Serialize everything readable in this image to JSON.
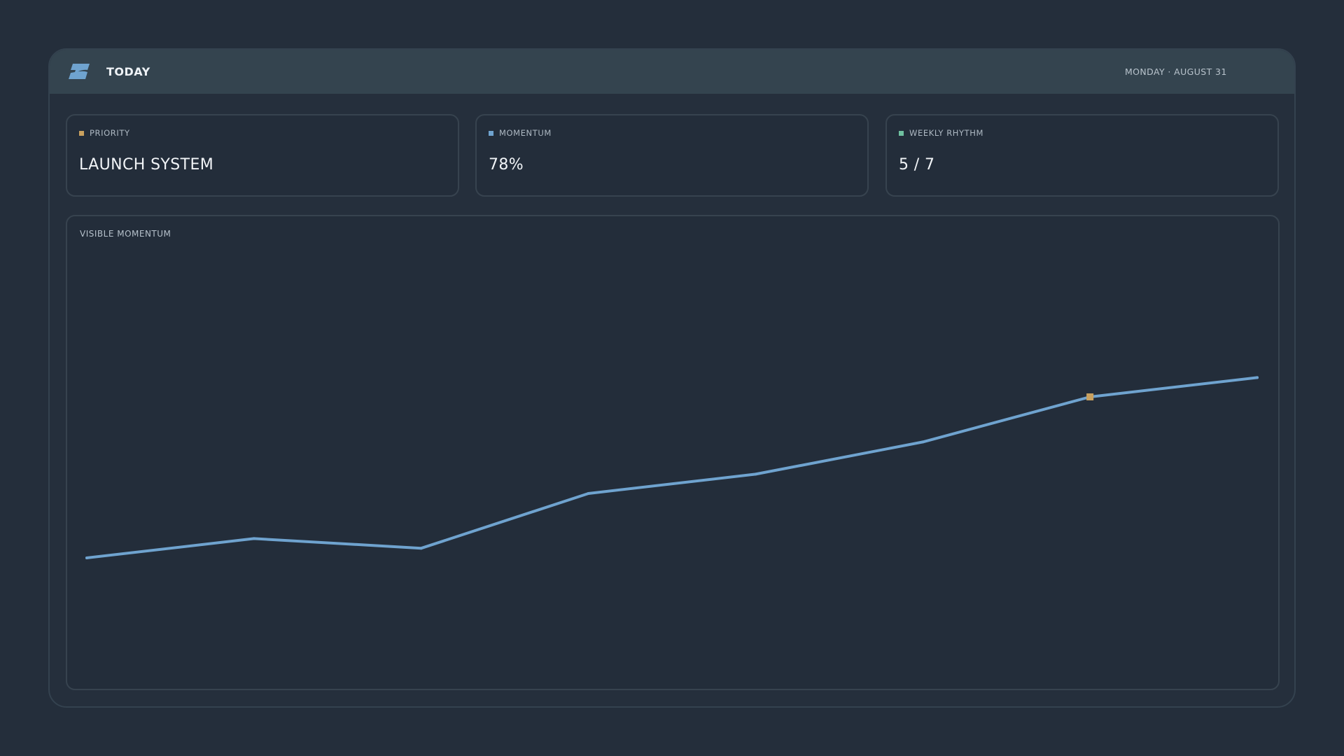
{
  "header": {
    "title": "TODAY",
    "date": "MONDAY · AUGUST 31",
    "logo_icon": "stripe-logo-icon"
  },
  "cards": [
    {
      "label": "PRIORITY",
      "value": "LAUNCH SYSTEM",
      "color": "#c9a15f"
    },
    {
      "label": "MOMENTUM",
      "value": "78%",
      "color": "#6fa3cf"
    },
    {
      "label": "WEEKLY RHYTHM",
      "value": "5 / 7",
      "color": "#6fc0a0"
    }
  ],
  "chart": {
    "title": "VISIBLE MOMENTUM"
  },
  "chart_data": {
    "type": "line",
    "title": "VISIBLE MOMENTUM",
    "xlabel": "",
    "ylabel": "",
    "grid": false,
    "legend": "none",
    "line_color": "#6fa3cf",
    "highlight_color": "#c9a15f",
    "x": [
      1,
      2,
      3,
      4,
      5,
      6,
      7,
      8
    ],
    "values": [
      20,
      26,
      23,
      40,
      46,
      56,
      70,
      76
    ],
    "highlight_index": 6,
    "ylim": [
      0,
      100
    ]
  },
  "colors": {
    "background": "#242e3b",
    "topbar": "#34444f",
    "accent": "#6fa3cf"
  }
}
